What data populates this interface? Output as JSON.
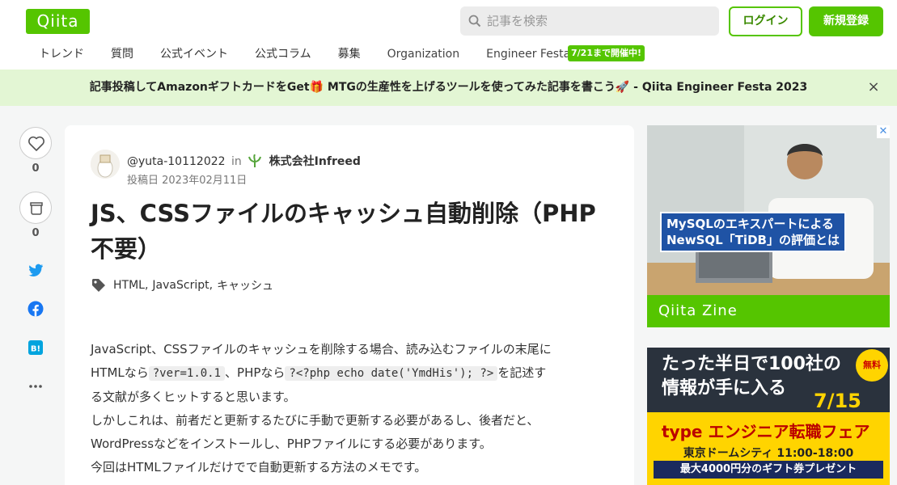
{
  "header": {
    "logo": "Qiita",
    "search_placeholder": "記事を検索",
    "login": "ログイン",
    "signup": "新規登録",
    "nav": [
      "トレンド",
      "質問",
      "公式イベント",
      "公式コラム",
      "募集",
      "Organization",
      "Engineer Festa"
    ],
    "festa_badge": "7/21まで開催中!"
  },
  "banner": {
    "text": "記事投稿してAmazonギフトカードをGet🎁 MTGの生産性を上げるツールを使ってみた記事を書こう🚀 - Qiita Engineer Festa 2023",
    "close": "×"
  },
  "sidebar": {
    "like_count": "0",
    "stock_count": "0",
    "icons": [
      "heart-icon",
      "stock-icon",
      "twitter-icon",
      "facebook-icon",
      "hatena-bookmark-icon",
      "more-icon"
    ]
  },
  "article": {
    "author": "@yuta-10112022",
    "in": "in",
    "organization": "株式会社Infreed",
    "posted": "投稿日 2023年02月11日",
    "title": "JS、CSSファイルのキャッシュ自動削除（PHP不要）",
    "tags": [
      "HTML",
      "JavaScript",
      "キャッシュ"
    ],
    "body": {
      "l1": "JavaScript、CSSファイルのキャッシュを削除する場合、読み込むファイルの末尾に",
      "l2a": "HTMLなら",
      "code1": "?ver=1.0.1",
      "l2b": "、PHPなら",
      "code2": "?<?php echo date('YmdHis'); ?>",
      "l2c": "を記述す",
      "l3": "る文献が多くヒットすると思います。",
      "l4": "しかしこれは、前者だと更新するたびに手動で更新する必要があるし、後者だと、",
      "l5": "WordPressなどをインストールし、PHPファイルにする必要があります。",
      "l6": "今回はHTMLファイルだけでで自動更新する方法のメモです。"
    }
  },
  "ads": {
    "ad1_caption_1": "MySQLのエキスパートによる",
    "ad1_caption_2": "NewSQL「TiDB」の評価とは",
    "ad1_footer": "Qiita Zine",
    "ad2_line1": "たった半日で100社の",
    "ad2_line2": "情報が手に入る",
    "ad2_date": "7/15",
    "ad2_free": "無料",
    "ad2_brand": "type エンジニア転職フェア",
    "ad2_venue": "東京ドームシティ 11:00-18:00",
    "ad2_gift": "最大4000円分のギフト券プレゼント"
  },
  "colors": {
    "brand": "#55c500",
    "banner_bg": "#e3f6d4",
    "page_bg": "#f5f6f6"
  }
}
